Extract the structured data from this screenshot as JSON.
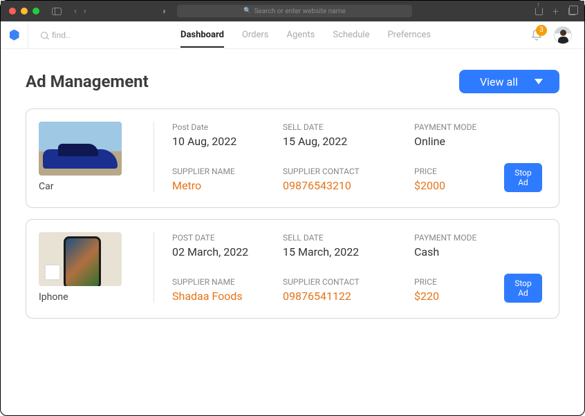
{
  "browser": {
    "addressPlaceholder": "Search or enter website name"
  },
  "header": {
    "searchPlaceholder": "find..",
    "tabs": [
      "Dashboard",
      "Orders",
      "Agents",
      "Schedule",
      "Prefernces"
    ],
    "activeTab": 0,
    "notificationCount": "3"
  },
  "page": {
    "title": "Ad Management",
    "viewAll": "View all"
  },
  "labels": {
    "postDate": "Post Date",
    "postDateUpper": "POST DATE",
    "sellDate": "SELL DATE",
    "paymentMode": "PAYMENT MODE",
    "supplierName": "SUPPLIER NAME",
    "supplierContact": "SUPPLIER CONTACT",
    "price": "PRICE",
    "stopAd": "Stop Ad"
  },
  "ads": [
    {
      "name": "Car",
      "thumb": "car",
      "postDate": "10 Aug, 2022",
      "sellDate": "15 Aug, 2022",
      "paymentMode": "Online",
      "supplierName": "Metro",
      "supplierContact": "09876543210",
      "price": "$2000"
    },
    {
      "name": "Iphone",
      "thumb": "phone",
      "postDate": "02 March, 2022",
      "sellDate": "15 March, 2022",
      "paymentMode": "Cash",
      "supplierName": "Shadaa Foods",
      "supplierContact": "09876541122",
      "price": "$220"
    }
  ]
}
